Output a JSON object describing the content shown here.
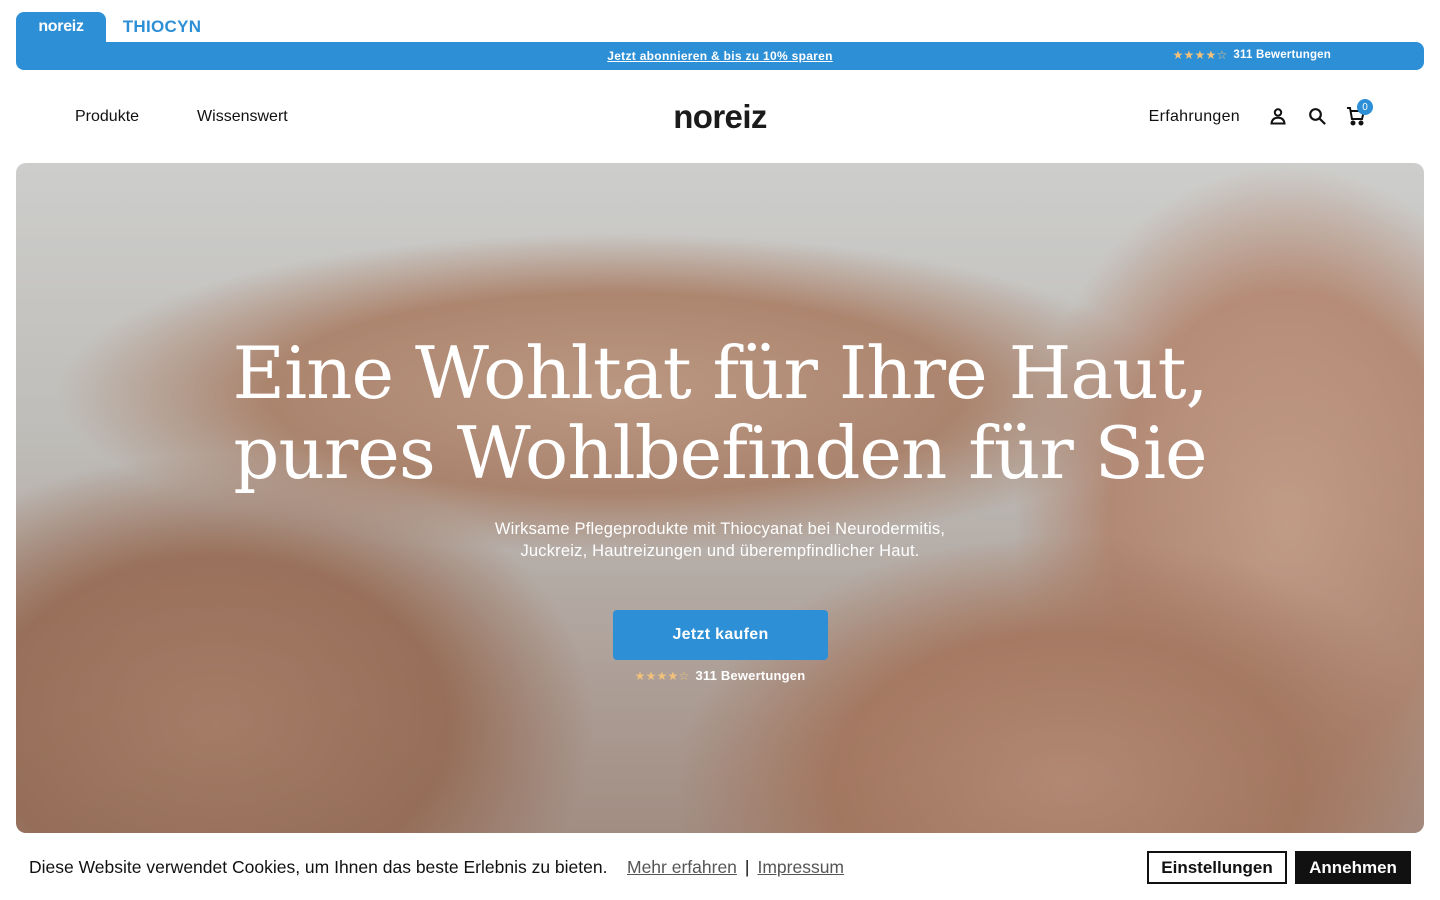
{
  "brands": {
    "active": "noreiz",
    "inactive": "THIOCYN"
  },
  "announcement": {
    "link": "Jetzt abonnieren & bis zu 10% sparen",
    "rating_stars": 4,
    "rating_max": 5,
    "rating_text": "311 Bewertungen"
  },
  "header": {
    "nav_left": [
      "Produkte",
      "Wissenswert"
    ],
    "logo": "noreiz",
    "nav_right": "Erfahrungen",
    "cart_count": "0",
    "icons": [
      "account-icon",
      "search-icon",
      "cart-icon"
    ]
  },
  "hero": {
    "title_line1": "Eine Wohltat für Ihre Haut,",
    "title_line2": "pures Wohlbefinden für Sie",
    "subtitle_line1": "Wirksame Pflegeprodukte mit Thiocyanat bei Neurodermitis,",
    "subtitle_line2": "Juckreiz, Hautreizungen und überempfindlicher Haut.",
    "cta": "Jetzt kaufen",
    "rating_stars": 4,
    "rating_max": 5,
    "rating_text": "311 Bewertungen"
  },
  "cookie": {
    "text": "Diese Website verwendet Cookies, um Ihnen das beste Erlebnis zu bieten.",
    "link_more": "Mehr erfahren",
    "separator": "|",
    "link_imprint": "Impressum",
    "settings": "Einstellungen",
    "accept": "Annehmen"
  },
  "colors": {
    "accent": "#2d8fd5",
    "star": "#f2c27c",
    "dark": "#111111"
  }
}
